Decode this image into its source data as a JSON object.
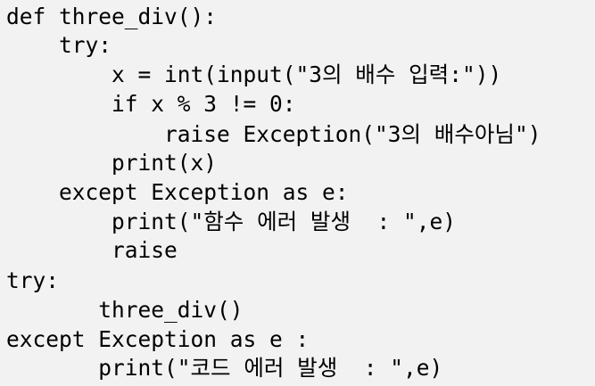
{
  "code": {
    "lines": [
      "def three_div():",
      "    try:",
      "        x = int(input(\"3의 배수 입력:\"))",
      "        if x % 3 != 0:",
      "            raise Exception(\"3의 배수아님\")",
      "        print(x)",
      "    except Exception as e:",
      "        print(\"함수 에러 발생  : \",e)",
      "        raise",
      "try:",
      "       three_div()",
      "except Exception as e :",
      "       print(\"코드 에러 발생  : \",e)"
    ]
  },
  "colors": {
    "background": "#f2f2f2",
    "text": "#000000"
  }
}
